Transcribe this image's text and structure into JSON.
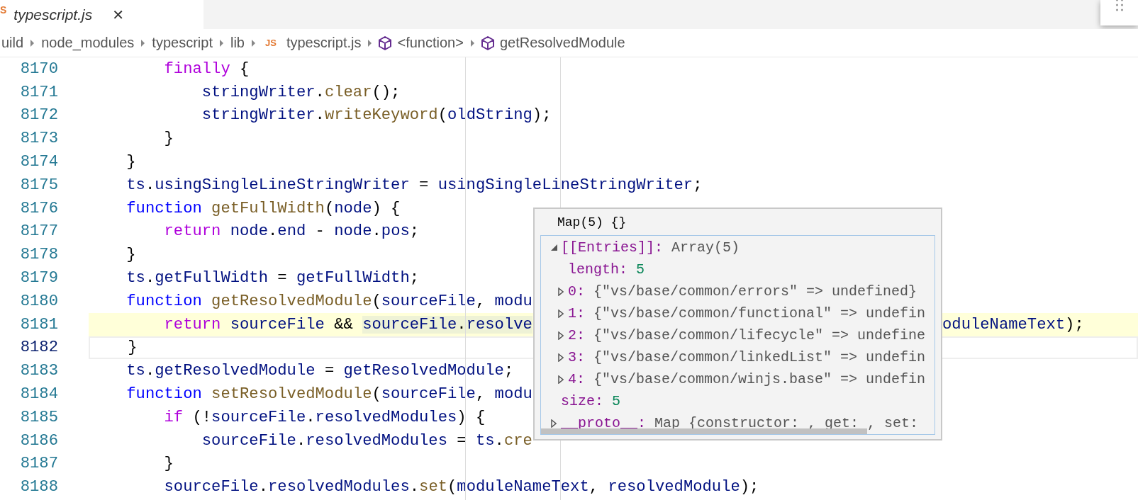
{
  "tab": {
    "icon_text": "S",
    "label": "typescript.js",
    "close": "✕"
  },
  "breadcrumbs": [
    {
      "label": "uild",
      "kind": "folder"
    },
    {
      "label": "node_modules",
      "kind": "folder"
    },
    {
      "label": "typescript",
      "kind": "folder"
    },
    {
      "label": "lib",
      "kind": "folder"
    },
    {
      "label": "typescript.js",
      "kind": "file",
      "icon_text": "JS"
    },
    {
      "label": "<function>",
      "kind": "symbol"
    },
    {
      "label": "getResolvedModule",
      "kind": "symbol"
    }
  ],
  "editor": {
    "lines": [
      {
        "number": "8170",
        "highlighted": false,
        "current": false,
        "tokens": [
          {
            "text": "        finally",
            "kind": "keyword"
          },
          {
            "text": " {",
            "kind": "plain"
          }
        ]
      },
      {
        "number": "8171",
        "highlighted": false,
        "current": false,
        "tokens": [
          {
            "text": "            stringWriter",
            "kind": "variable"
          },
          {
            "text": ".",
            "kind": "plain"
          },
          {
            "text": "clear",
            "kind": "function"
          },
          {
            "text": "();",
            "kind": "plain"
          }
        ]
      },
      {
        "number": "8172",
        "highlighted": false,
        "current": false,
        "tokens": [
          {
            "text": "            stringWriter",
            "kind": "variable"
          },
          {
            "text": ".",
            "kind": "plain"
          },
          {
            "text": "writeKeyword",
            "kind": "function"
          },
          {
            "text": "(",
            "kind": "plain"
          },
          {
            "text": "oldString",
            "kind": "variable"
          },
          {
            "text": ");",
            "kind": "plain"
          }
        ]
      },
      {
        "number": "8173",
        "highlighted": false,
        "current": false,
        "tokens": [
          {
            "text": "        }",
            "kind": "plain"
          }
        ]
      },
      {
        "number": "8174",
        "highlighted": false,
        "current": false,
        "tokens": [
          {
            "text": "    }",
            "kind": "plain"
          }
        ]
      },
      {
        "number": "8175",
        "highlighted": false,
        "current": false,
        "tokens": [
          {
            "text": "    ts",
            "kind": "variable"
          },
          {
            "text": ".",
            "kind": "plain"
          },
          {
            "text": "usingSingleLineStringWriter",
            "kind": "variable"
          },
          {
            "text": " = ",
            "kind": "plain"
          },
          {
            "text": "usingSingleLineStringWriter",
            "kind": "variable"
          },
          {
            "text": ";",
            "kind": "plain"
          }
        ]
      },
      {
        "number": "8176",
        "highlighted": false,
        "current": false,
        "tokens": [
          {
            "text": "    function",
            "kind": "storage"
          },
          {
            "text": " getFullWidth",
            "kind": "function"
          },
          {
            "text": "(",
            "kind": "plain"
          },
          {
            "text": "node",
            "kind": "variable"
          },
          {
            "text": ") {",
            "kind": "plain"
          }
        ]
      },
      {
        "number": "8177",
        "highlighted": false,
        "current": false,
        "tokens": [
          {
            "text": "        return",
            "kind": "keyword"
          },
          {
            "text": " node",
            "kind": "variable"
          },
          {
            "text": ".",
            "kind": "plain"
          },
          {
            "text": "end",
            "kind": "variable"
          },
          {
            "text": " - ",
            "kind": "plain"
          },
          {
            "text": "node",
            "kind": "variable"
          },
          {
            "text": ".",
            "kind": "plain"
          },
          {
            "text": "pos",
            "kind": "variable"
          },
          {
            "text": ";",
            "kind": "plain"
          }
        ]
      },
      {
        "number": "8178",
        "highlighted": false,
        "current": false,
        "tokens": [
          {
            "text": "    }",
            "kind": "plain"
          }
        ]
      },
      {
        "number": "8179",
        "highlighted": false,
        "current": false,
        "tokens": [
          {
            "text": "    ts",
            "kind": "variable"
          },
          {
            "text": ".",
            "kind": "plain"
          },
          {
            "text": "getFullWidth",
            "kind": "variable"
          },
          {
            "text": " = ",
            "kind": "plain"
          },
          {
            "text": "getFullWidth",
            "kind": "variable"
          },
          {
            "text": ";",
            "kind": "plain"
          }
        ]
      },
      {
        "number": "8180",
        "highlighted": false,
        "current": false,
        "tokens": [
          {
            "text": "    function",
            "kind": "storage"
          },
          {
            "text": " getResolvedModule",
            "kind": "function"
          },
          {
            "text": "(",
            "kind": "plain"
          },
          {
            "text": "sourceFile",
            "kind": "variable"
          },
          {
            "text": ", ",
            "kind": "plain"
          },
          {
            "text": "modu",
            "kind": "variable"
          }
        ]
      },
      {
        "number": "8181",
        "highlighted": true,
        "current": false,
        "tokens": [
          {
            "text": "        return",
            "kind": "keyword",
            "in_range": false
          },
          {
            "text": " sourceFile",
            "kind": "variable",
            "in_range": false
          },
          {
            "text": " && ",
            "kind": "plain",
            "in_range": false
          },
          {
            "text": "sourceFile",
            "kind": "variable",
            "in_range": true
          },
          {
            "text": ".",
            "kind": "plain",
            "in_range": true
          },
          {
            "text": "resolve",
            "kind": "variable",
            "in_range": true
          }
        ],
        "tail": [
          {
            "text": "oduleNameText",
            "kind": "variable"
          },
          {
            "text": ");",
            "kind": "plain"
          }
        ]
      },
      {
        "number": "8182",
        "highlighted": false,
        "current": true,
        "tokens": [
          {
            "text": "    }",
            "kind": "plain"
          }
        ]
      },
      {
        "number": "8183",
        "highlighted": false,
        "current": false,
        "tokens": [
          {
            "text": "    ts",
            "kind": "variable"
          },
          {
            "text": ".",
            "kind": "plain"
          },
          {
            "text": "getResolvedModule",
            "kind": "variable"
          },
          {
            "text": " = ",
            "kind": "plain"
          },
          {
            "text": "getResolvedModule",
            "kind": "variable"
          },
          {
            "text": ";",
            "kind": "plain"
          }
        ]
      },
      {
        "number": "8184",
        "highlighted": false,
        "current": false,
        "tokens": [
          {
            "text": "    function",
            "kind": "storage"
          },
          {
            "text": " setResolvedModule",
            "kind": "function"
          },
          {
            "text": "(",
            "kind": "plain"
          },
          {
            "text": "sourceFile",
            "kind": "variable"
          },
          {
            "text": ", ",
            "kind": "plain"
          },
          {
            "text": "modu",
            "kind": "variable"
          }
        ]
      },
      {
        "number": "8185",
        "highlighted": false,
        "current": false,
        "tokens": [
          {
            "text": "        if",
            "kind": "keyword"
          },
          {
            "text": " (!",
            "kind": "plain"
          },
          {
            "text": "sourceFile",
            "kind": "variable"
          },
          {
            "text": ".",
            "kind": "plain"
          },
          {
            "text": "resolvedModules",
            "kind": "variable"
          },
          {
            "text": ") {",
            "kind": "plain"
          }
        ]
      },
      {
        "number": "8186",
        "highlighted": false,
        "current": false,
        "tokens": [
          {
            "text": "            sourceFile",
            "kind": "variable"
          },
          {
            "text": ".",
            "kind": "plain"
          },
          {
            "text": "resolvedModules",
            "kind": "variable"
          },
          {
            "text": " = ",
            "kind": "plain"
          },
          {
            "text": "ts",
            "kind": "variable"
          },
          {
            "text": ".",
            "kind": "plain"
          },
          {
            "text": "cre",
            "kind": "function"
          }
        ]
      },
      {
        "number": "8187",
        "highlighted": false,
        "current": false,
        "tokens": [
          {
            "text": "        }",
            "kind": "plain"
          }
        ]
      },
      {
        "number": "8188",
        "highlighted": false,
        "current": false,
        "tokens": [
          {
            "text": "        sourceFile",
            "kind": "variable"
          },
          {
            "text": ".",
            "kind": "plain"
          },
          {
            "text": "resolvedModules",
            "kind": "variable"
          },
          {
            "text": ".",
            "kind": "plain"
          },
          {
            "text": "set",
            "kind": "function"
          },
          {
            "text": "(",
            "kind": "plain"
          },
          {
            "text": "moduleNameText",
            "kind": "variable"
          },
          {
            "text": ", ",
            "kind": "plain"
          },
          {
            "text": "resolvedModule",
            "kind": "variable"
          },
          {
            "text": ");",
            "kind": "plain"
          }
        ]
      }
    ]
  },
  "hover": {
    "title": "Map(5) {}",
    "tree": [
      {
        "key": "[[Entries]]:",
        "value": "Array(5)",
        "kind": "object",
        "expanded": true,
        "children": [
          {
            "key": "length:",
            "value": "5",
            "kind": "number"
          },
          {
            "key": "0:",
            "value": "{\"vs/base/common/errors\" => undefined}",
            "kind": "object",
            "expanded": false
          },
          {
            "key": "1:",
            "value": "{\"vs/base/common/functional\" => undefin",
            "kind": "object",
            "expanded": false
          },
          {
            "key": "2:",
            "value": "{\"vs/base/common/lifecycle\" => undefine",
            "kind": "object",
            "expanded": false
          },
          {
            "key": "3:",
            "value": "{\"vs/base/common/linkedList\" => undefin",
            "kind": "object",
            "expanded": false
          },
          {
            "key": "4:",
            "value": "{\"vs/base/common/winjs.base\" => undefin",
            "kind": "object",
            "expanded": false
          }
        ]
      },
      {
        "key": "size:",
        "value": "5",
        "kind": "number"
      },
      {
        "key": "__proto__:",
        "value": "Map {constructor: , get: , set: ",
        "kind": "object",
        "expanded": false
      }
    ]
  }
}
